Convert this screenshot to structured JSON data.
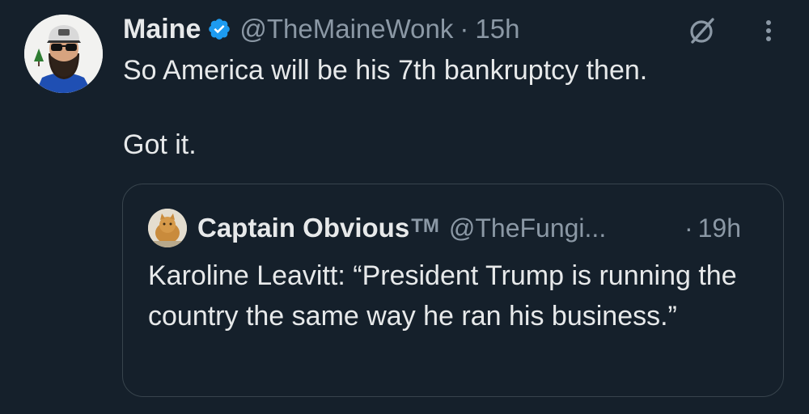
{
  "tweet": {
    "author": {
      "display_name": "Maine",
      "handle": "@TheMaineWonk",
      "verified": true,
      "verified_color": "#1d9bf0"
    },
    "separator": "·",
    "time": "15h",
    "text_line1": "So America will be his 7th bankruptcy then.",
    "text_line2": "Got it.",
    "actions": {
      "grok_icon": "grok-icon",
      "more_icon": "more-options-icon"
    }
  },
  "quote": {
    "author": {
      "display_name": "Captain Obvious",
      "trademark": "TM",
      "handle": "@TheFungi..."
    },
    "separator": "·",
    "time": "19h",
    "text": "Karoline Leavitt: “President Trump is running the country the same way he ran his business.”"
  },
  "colors": {
    "background": "#15202b",
    "text_primary": "#e7e9ea",
    "text_secondary": "#8b98a5",
    "border": "#38444d"
  }
}
